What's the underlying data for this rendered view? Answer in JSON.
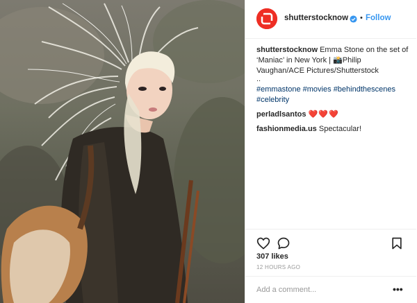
{
  "post": {
    "username": "shutterstocknow",
    "follow_label": "Follow",
    "separator": "•",
    "caption_user": "shutterstocknow",
    "caption_text": " Emma Stone on the set of ‘Maniac’ in New York | 📸Philip Vaughan/ACE Pictures/Shutterstock",
    "caption_dots": "..",
    "hashtags": [
      "#emmastone",
      "#movies",
      "#behindthescenes",
      "#celebrity"
    ],
    "comments": [
      {
        "user": "perladlsantos",
        "text": "❤️❤️❤️"
      },
      {
        "user": "fashionmedia.us",
        "text": "Spectacular!"
      }
    ],
    "likes": "307 likes",
    "time": "12 HOURS AGO",
    "add_comment_placeholder": "Add a comment...",
    "more_label": "•••"
  },
  "colors": {
    "brand": "#ee2e24",
    "link": "#3897f0",
    "hashtag": "#003569",
    "muted": "#999999"
  },
  "icons": [
    "shutterstock-logo-icon",
    "verified-badge-icon",
    "heart-icon",
    "comment-icon",
    "bookmark-icon",
    "more-options-icon"
  ]
}
